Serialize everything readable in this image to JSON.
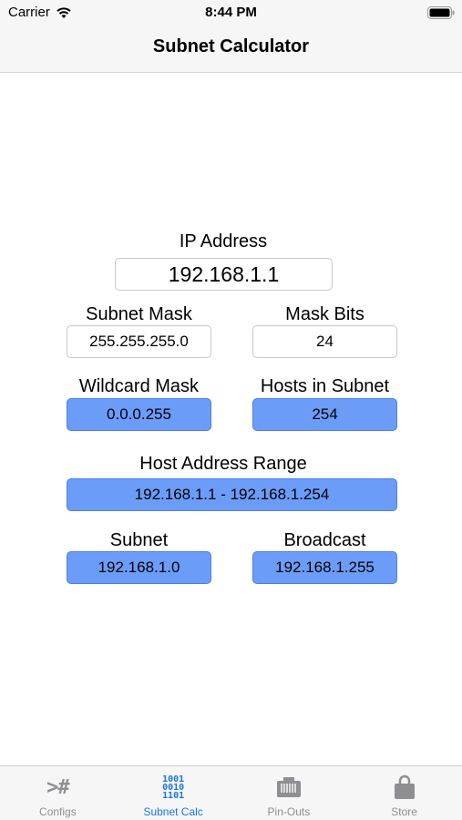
{
  "status_bar": {
    "carrier": "Carrier",
    "time": "8:44 PM"
  },
  "nav": {
    "title": "Subnet Calculator"
  },
  "calculator": {
    "ip_address": {
      "label": "IP Address",
      "value": "192.168.1.1"
    },
    "subnet_mask": {
      "label": "Subnet Mask",
      "value": "255.255.255.0"
    },
    "mask_bits": {
      "label": "Mask Bits",
      "value": "24"
    },
    "wildcard_mask": {
      "label": "Wildcard Mask",
      "value": "0.0.0.255"
    },
    "hosts_in_subnet": {
      "label": "Hosts in Subnet",
      "value": "254"
    },
    "host_address_range": {
      "label": "Host Address Range",
      "value": "192.168.1.1 - 192.168.1.254"
    },
    "subnet": {
      "label": "Subnet",
      "value": "192.168.1.0"
    },
    "broadcast": {
      "label": "Broadcast",
      "value": "192.168.1.255"
    }
  },
  "tabs": [
    {
      "label": "Configs",
      "icon": "terminal-icon",
      "glyph": ">#"
    },
    {
      "label": "Subnet Calc",
      "icon": "binary-icon",
      "glyph_lines": [
        "1001",
        "0010",
        "1101"
      ],
      "active": true
    },
    {
      "label": "Pin-Outs",
      "icon": "connector-icon"
    },
    {
      "label": "Store",
      "icon": "shopping-bag-icon"
    }
  ],
  "colors": {
    "accent": "#1a73e8",
    "result_field": "#6b9cf8",
    "inactive": "#8e8e93"
  }
}
